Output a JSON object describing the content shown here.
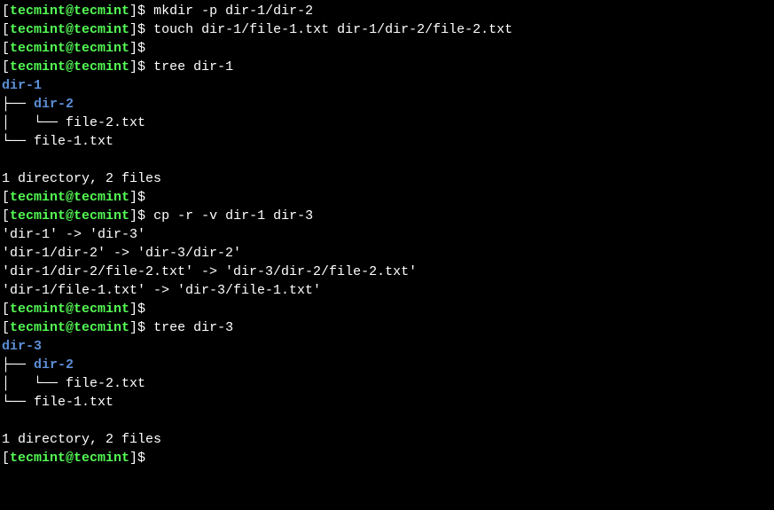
{
  "prompt": {
    "open_bracket": "[",
    "user_host": "tecmint@tecmint",
    "close_bracket_dollar": "]$"
  },
  "commands": {
    "mkdir": " mkdir -p dir-1/dir-2",
    "touch": " touch dir-1/file-1.txt dir-1/dir-2/file-2.txt",
    "empty": "",
    "tree1": " tree dir-1",
    "cp": " cp -r -v dir-1 dir-3",
    "tree3": " tree dir-3"
  },
  "tree1": {
    "root": "dir-1",
    "line1_branch": "├── ",
    "line1_dir": "dir-2",
    "line2": "│   └── file-2.txt",
    "line3": "└── file-1.txt"
  },
  "tree3": {
    "root": "dir-3",
    "line1_branch": "├── ",
    "line1_dir": "dir-2",
    "line2": "│   └── file-2.txt",
    "line3": "└── file-1.txt"
  },
  "cp_output": {
    "line1": "'dir-1' -> 'dir-3'",
    "line2": "'dir-1/dir-2' -> 'dir-3/dir-2'",
    "line3": "'dir-1/dir-2/file-2.txt' -> 'dir-3/dir-2/file-2.txt'",
    "line4": "'dir-1/file-1.txt' -> 'dir-3/file-1.txt'"
  },
  "summary": "1 directory, 2 files",
  "blank": " "
}
